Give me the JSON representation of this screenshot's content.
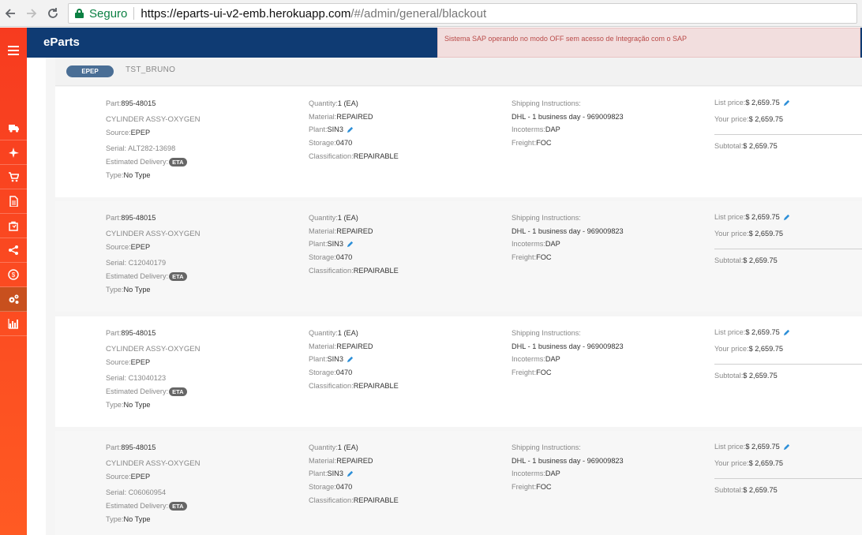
{
  "browser": {
    "back_icon": "arrow-left-icon",
    "forward_icon": "arrow-right-icon",
    "reload_icon": "reload-icon",
    "secure_label": "Seguro",
    "url_host": "https://eparts-ui-v2-emb.herokuapp.com",
    "url_path": "/#/admin/general/blackout"
  },
  "sidebar": {
    "menu_icon": "hamburger-menu-icon",
    "items": [
      {
        "icon": "truck-icon",
        "active": false
      },
      {
        "icon": "airplane-icon",
        "active": false
      },
      {
        "icon": "cart-icon",
        "active": false
      },
      {
        "icon": "document-icon",
        "active": false
      },
      {
        "icon": "bag-icon",
        "active": false
      },
      {
        "icon": "share-icon",
        "active": false
      },
      {
        "icon": "dollar-icon",
        "active": false
      },
      {
        "icon": "gears-icon",
        "active": true
      },
      {
        "icon": "bar-chart-icon",
        "active": false
      }
    ]
  },
  "header": {
    "brand": "eParts",
    "alert": "Sistema SAP operando no modo OFF sem acesso de Integração com o SAP"
  },
  "customer": {
    "code": "EPEP",
    "name": "TST_BRUNO"
  },
  "labels": {
    "part": "Part:",
    "source": "Source:",
    "serial": "Serial:",
    "estimated_delivery": "Estimated Delivery:",
    "eta": "ETA",
    "type": "Type:",
    "quantity": "Quantity:",
    "material": "Material:",
    "plant": "Plant:",
    "storage": "Storage:",
    "classification": "Classification:",
    "shipping_instructions": "Shipping Instructions:",
    "incoterms": "Incoterms:",
    "freight": "Freight:",
    "list_price": "List price:",
    "your_price": "Your price:",
    "subtotal": "Subtotal:"
  },
  "items": [
    {
      "part": "895-48015",
      "description": "CYLINDER ASSY-OXYGEN",
      "source": "EPEP",
      "serial": "ALT282-13698",
      "type": "No Type",
      "quantity": "1 (EA)",
      "material": "REPAIRED",
      "plant": "SIN3",
      "storage": "0470",
      "classification": "REPAIRABLE",
      "shipping": "DHL - 1 business day - 969009823",
      "incoterms": "DAP",
      "freight": "FOC",
      "list_price": "$ 2,659.75",
      "your_price": "$ 2,659.75",
      "subtotal": "$ 2,659.75"
    },
    {
      "part": "895-48015",
      "description": "CYLINDER ASSY-OXYGEN",
      "source": "EPEP",
      "serial": "C12040179",
      "type": "No Type",
      "quantity": "1 (EA)",
      "material": "REPAIRED",
      "plant": "SIN3",
      "storage": "0470",
      "classification": "REPAIRABLE",
      "shipping": "DHL - 1 business day - 969009823",
      "incoterms": "DAP",
      "freight": "FOC",
      "list_price": "$ 2,659.75",
      "your_price": "$ 2,659.75",
      "subtotal": "$ 2,659.75"
    },
    {
      "part": "895-48015",
      "description": "CYLINDER ASSY-OXYGEN",
      "source": "EPEP",
      "serial": "C13040123",
      "type": "No Type",
      "quantity": "1 (EA)",
      "material": "REPAIRED",
      "plant": "SIN3",
      "storage": "0470",
      "classification": "REPAIRABLE",
      "shipping": "DHL - 1 business day - 969009823",
      "incoterms": "DAP",
      "freight": "FOC",
      "list_price": "$ 2,659.75",
      "your_price": "$ 2,659.75",
      "subtotal": "$ 2,659.75"
    },
    {
      "part": "895-48015",
      "description": "CYLINDER ASSY-OXYGEN",
      "source": "EPEP",
      "serial": "C06060954",
      "type": "No Type",
      "quantity": "1 (EA)",
      "material": "REPAIRED",
      "plant": "SIN3",
      "storage": "0470",
      "classification": "REPAIRABLE",
      "shipping": "DHL - 1 business day - 969009823",
      "incoterms": "DAP",
      "freight": "FOC",
      "list_price": "$ 2,659.75",
      "your_price": "$ 2,659.75",
      "subtotal": "$ 2,659.75"
    }
  ],
  "colors": {
    "header": "#0f3b73",
    "sidebar": "#f73b1f",
    "alert_bg": "#f2dede",
    "alert_text": "#b94a48",
    "pencil": "#2d8fd8"
  }
}
